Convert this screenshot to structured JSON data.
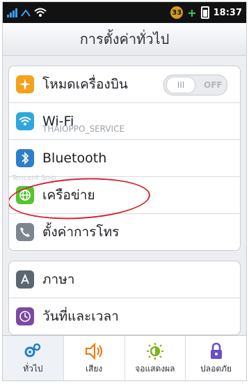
{
  "status": {
    "badge_count": "33",
    "time": "18:37"
  },
  "header": {
    "title": "การตั้งค่าทั่วไป"
  },
  "group1": {
    "airplane": {
      "label": "โหมดเครื่องบิน",
      "toggle": {
        "knob": "III",
        "state": "OFF"
      }
    },
    "wifi": {
      "label": "Wi-Fi",
      "network": "THAIOPPO_SERVICE"
    },
    "bluetooth": {
      "label": "Bluetooth"
    },
    "network": {
      "label": "เครือข่าย",
      "ghost_text": "Tencent Snip"
    },
    "call": {
      "label": "ตั้งค่าการโทร"
    }
  },
  "group2": {
    "language": {
      "label": "ภาษา"
    },
    "datetime": {
      "label": "วันที่และเวลา"
    }
  },
  "tabbar": {
    "tabs": [
      {
        "label": "ทั่วไป"
      },
      {
        "label": "เสียง"
      },
      {
        "label": "จอแสดงผล"
      },
      {
        "label": "ปลอดภัย"
      }
    ]
  },
  "colors": {
    "airplane_icon": "#f3a21b",
    "wifi_icon": "#2ea6de",
    "bluetooth_icon": "#2d7ec9",
    "network_icon": "#57c232",
    "call_icon": "#7d868f",
    "language_icon": "#5c6670",
    "datetime_icon": "#7a4aa3",
    "highlight_ellipse": "#d5242e"
  }
}
